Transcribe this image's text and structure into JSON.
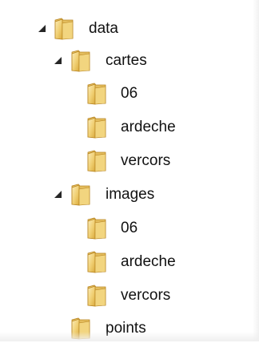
{
  "tree": {
    "root": {
      "label": "data",
      "expanded": true,
      "children": {
        "cartes": {
          "label": "cartes",
          "expanded": true,
          "children": {
            "item_06": {
              "label": "06"
            },
            "item_ardeche": {
              "label": "ardeche"
            },
            "item_vercors": {
              "label": "vercors"
            }
          }
        },
        "images": {
          "label": "images",
          "expanded": true,
          "children": {
            "item_06": {
              "label": "06"
            },
            "item_ardeche": {
              "label": "ardeche"
            },
            "item_vercors": {
              "label": "vercors"
            }
          }
        },
        "points": {
          "label": "points",
          "expanded": false
        }
      }
    }
  },
  "icons": {
    "folder": "folder-icon",
    "expander": "expanded-triangle-icon"
  },
  "colors": {
    "folder_light": "#f7e3a0",
    "folder_dark": "#d9a93c",
    "folder_edge": "#b88522",
    "expander": "#262626",
    "text": "#111111"
  }
}
